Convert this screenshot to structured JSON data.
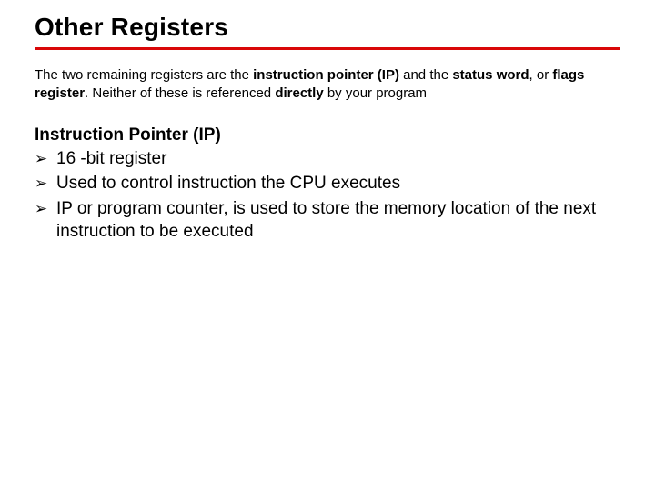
{
  "title": "Other Registers",
  "intro": {
    "t1": "The two remaining registers are the ",
    "b1": "instruction pointer (IP)",
    "t2": " and the ",
    "b2": "status word",
    "t3": ", or ",
    "b3": "flags register",
    "t4": ". Neither of these is referenced ",
    "b4": "directly",
    "t5": " by your program"
  },
  "subhead": "Instruction Pointer (IP)",
  "bullets": [
    "16 -bit register",
    "Used to control instruction the CPU executes",
    "IP or program counter, is used to store the memory location of the next instruction to be executed"
  ]
}
